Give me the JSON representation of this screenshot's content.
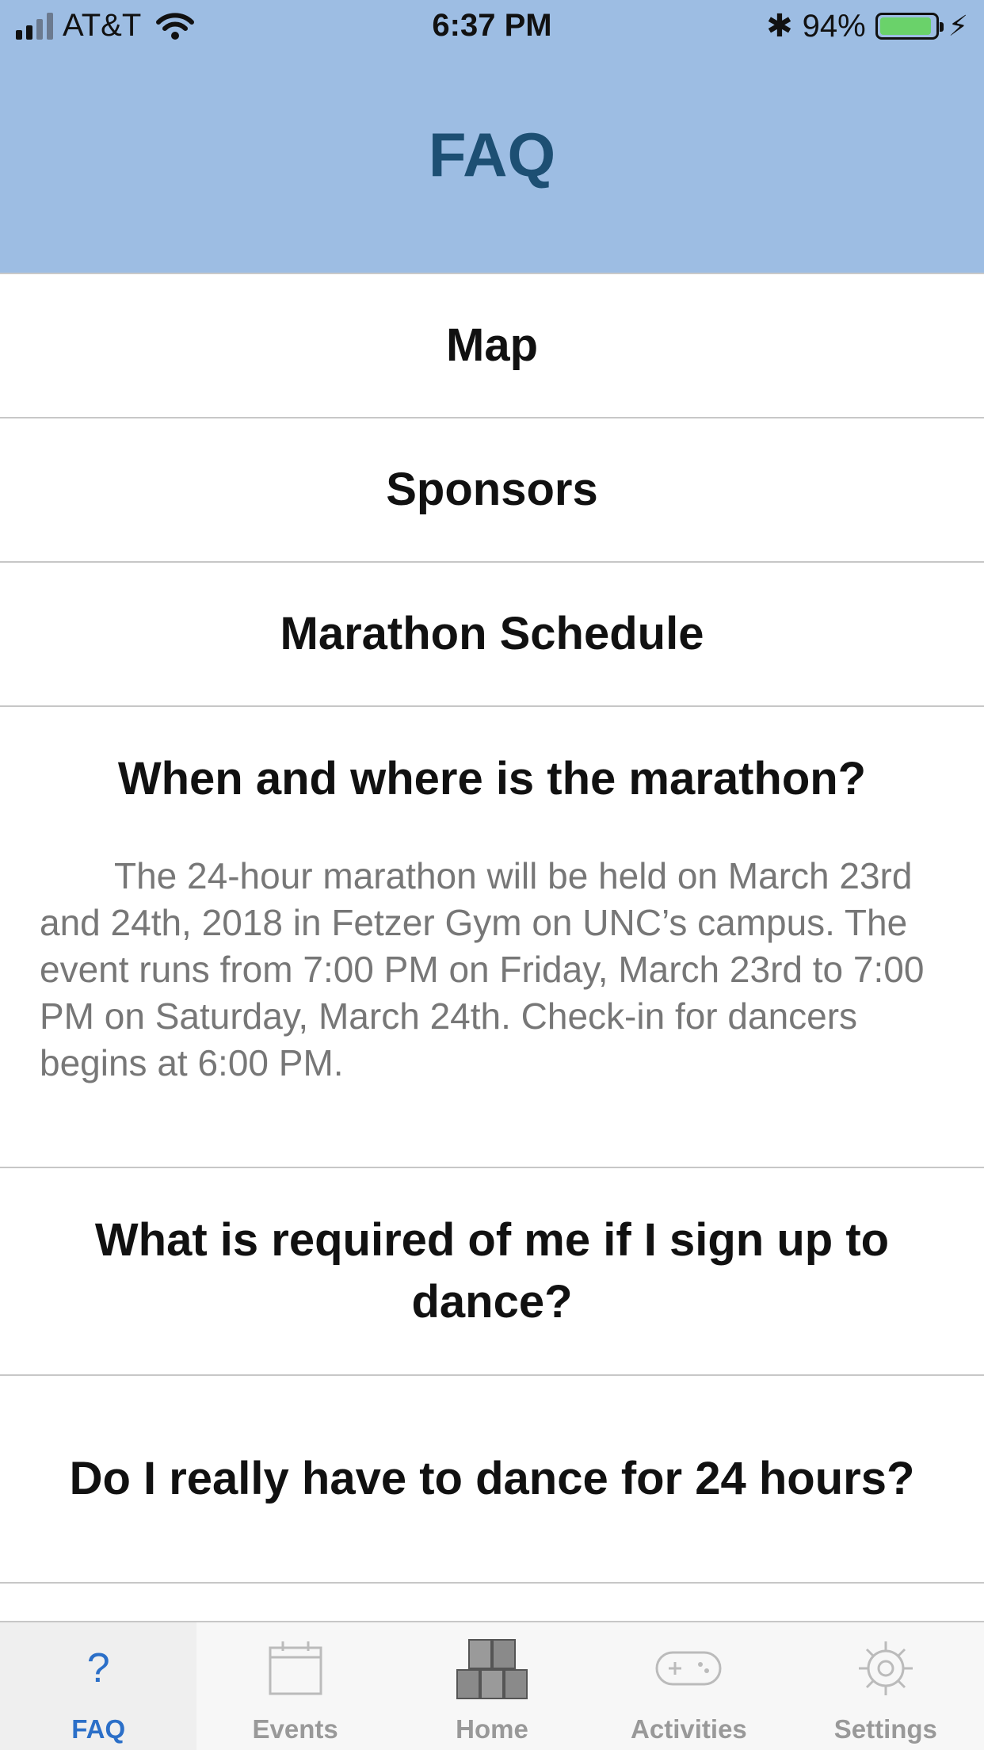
{
  "status_bar": {
    "carrier": "AT&T",
    "time": "6:37 PM",
    "battery_percent": "94%",
    "battery_level": 0.94,
    "bluetooth": "✱",
    "charging": "⚡"
  },
  "header": {
    "title": "FAQ"
  },
  "list": {
    "map": "Map",
    "sponsors": "Sponsors",
    "schedule": "Marathon Schedule",
    "q1": {
      "question": "When and where is the marathon?",
      "answer": "The 24-hour marathon will be held on March 23rd and 24th, 2018 in Fetzer Gym on UNC’s campus. The event runs from 7:00 PM on Friday, March 23rd to 7:00 PM on Saturday, March 24th. Check-in for dancers begins at 6:00 PM."
    },
    "q2": "What is required of me if I sign up to dance?",
    "q3": "Do I really have to dance for 24 hours?"
  },
  "tabs": [
    {
      "label": "FAQ",
      "icon": "question-icon",
      "active": true
    },
    {
      "label": "Events",
      "icon": "calendar-icon",
      "active": false
    },
    {
      "label": "Home",
      "icon": "blocks-icon",
      "active": false
    },
    {
      "label": "Activities",
      "icon": "gamepad-icon",
      "active": false
    },
    {
      "label": "Settings",
      "icon": "gear-icon",
      "active": false
    }
  ],
  "colors": {
    "header_bg": "#9dbde3",
    "title": "#1d4f73",
    "active_tab": "#2b6fc8",
    "inactive_tab": "#999999",
    "answer_text": "#777777"
  }
}
